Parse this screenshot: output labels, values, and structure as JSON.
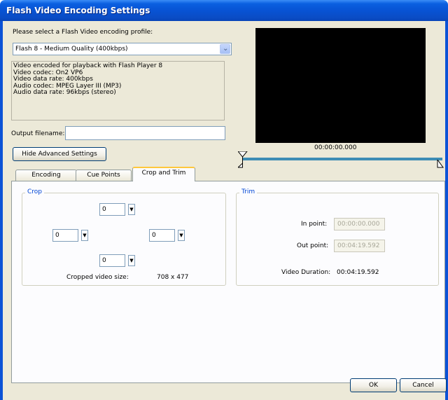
{
  "window": {
    "title": "Flash Video Encoding Settings"
  },
  "profile": {
    "prompt": "Please select a Flash Video encoding profile:",
    "selected": "Flash 8 - Medium Quality (400kbps)",
    "description": [
      "Video encoded for playback with Flash Player 8",
      "Video codec: On2 VP6",
      "Video data rate: 400kbps",
      "Audio codec: MPEG Layer III (MP3)",
      "Audio data rate: 96kbps (stereo)"
    ]
  },
  "output": {
    "label": "Output filename:",
    "value": ""
  },
  "advanced_button": "Hide Advanced Settings",
  "preview": {
    "timecode": "00:00:00.000"
  },
  "tabs": [
    {
      "label": "Encoding"
    },
    {
      "label": "Cue Points"
    },
    {
      "label": "Crop and Trim"
    }
  ],
  "crop": {
    "legend": "Crop",
    "top": "0",
    "left": "0",
    "right": "0",
    "bottom": "0",
    "size_label": "Cropped video size:",
    "size_value": "708 x 477"
  },
  "trim": {
    "legend": "Trim",
    "in_label": "In point:",
    "in_value": "00:00:00.000",
    "out_label": "Out point:",
    "out_value": "00:04:19.592",
    "duration_label": "Video Duration:",
    "duration_value": "00:04:19.592"
  },
  "buttons": {
    "ok": "OK",
    "cancel": "Cancel"
  }
}
